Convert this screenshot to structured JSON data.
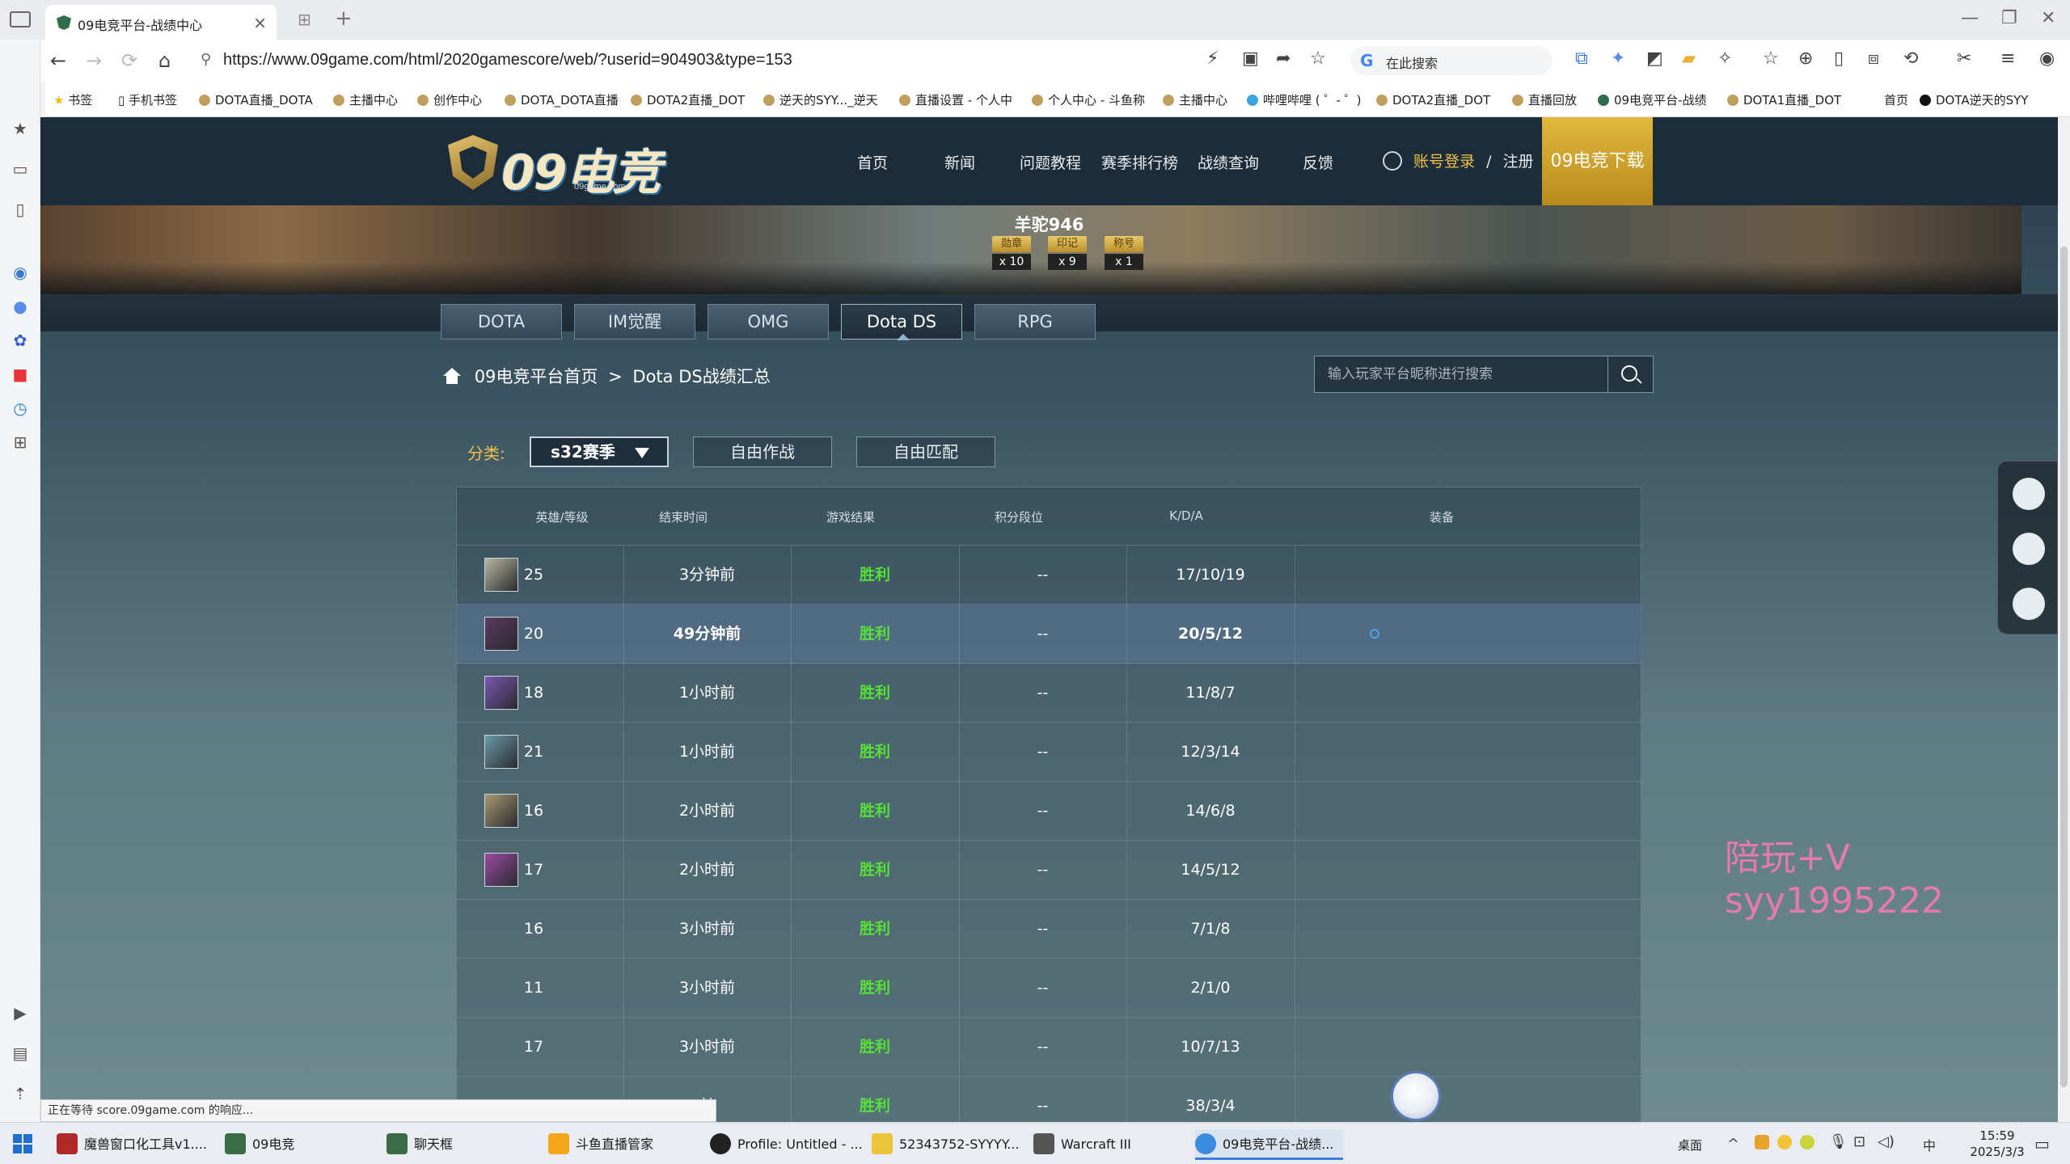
{
  "browser": {
    "tab_title": "09电竞平台-战绩中心",
    "url": "https://www.09game.com/html/2020gamescore/web/?userid=904903&type=153",
    "search_placeholder": "在此搜索",
    "bookmarks": [
      "书签",
      "手机书签",
      "DOTA直播_DOTA",
      "主播中心",
      "创作中心",
      "DOTA_DOTA直播",
      "DOTA2直播_DOT",
      "逆天的SYY..._逆天",
      "直播设置 - 个人中",
      "个人中心 - 斗鱼称",
      "主播中心",
      "哔哩哔哩 ( ゜- ゜)",
      "DOTA2直播_DOT",
      "直播回放",
      "09电竞平台-战绩",
      "DOTA1直播_DOT",
      "首页",
      "DOTA逆天的SYY"
    ],
    "status": "正在等待 score.09game.com 的响应..."
  },
  "site": {
    "logo_text": "09电竞",
    "logo_sub": "09game.com",
    "nav": [
      "首页",
      "新闻",
      "问题教程",
      "赛季排行榜",
      "战绩查询",
      "反馈"
    ],
    "login": "账号登录",
    "login_sep": "/",
    "register": "注册",
    "download": "09电竞下载"
  },
  "profile": {
    "username": "羊驼946",
    "badges": [
      {
        "label": "勋章",
        "count": "x 10"
      },
      {
        "label": "印记",
        "count": "x 9"
      },
      {
        "label": "称号",
        "count": "x 1"
      }
    ]
  },
  "game_tabs": [
    "DOTA",
    "IM觉醒",
    "OMG",
    "Dota DS",
    "RPG"
  ],
  "active_tab": "Dota DS",
  "breadcrumb": {
    "home": "09电竞平台首页",
    "sep": ">",
    "current": "Dota DS战绩汇总"
  },
  "search": {
    "placeholder": "输入玩家平台昵称进行搜索"
  },
  "filter": {
    "label": "分类:",
    "season": "s32赛季",
    "modes": [
      "自由作战",
      "自由匹配"
    ]
  },
  "table": {
    "headers": [
      "英雄/等级",
      "结束时间",
      "游戏结果",
      "积分段位",
      "K/D/A",
      "装备"
    ],
    "rows": [
      {
        "level": "25",
        "time": "3分钟前",
        "result": "胜利",
        "rank": "--",
        "kda": "17/10/19",
        "hero_color": "#b8b8a0"
      },
      {
        "level": "20",
        "time": "49分钟前",
        "result": "胜利",
        "rank": "--",
        "kda": "20/5/12",
        "hero_color": "#5a3a5e"
      },
      {
        "level": "18",
        "time": "1小时前",
        "result": "胜利",
        "rank": "--",
        "kda": "11/8/7",
        "hero_color": "#7a58b0"
      },
      {
        "level": "21",
        "time": "1小时前",
        "result": "胜利",
        "rank": "--",
        "kda": "12/3/14",
        "hero_color": "#6a9aa8"
      },
      {
        "level": "16",
        "time": "2小时前",
        "result": "胜利",
        "rank": "--",
        "kda": "14/6/8",
        "hero_color": "#a89870"
      },
      {
        "level": "17",
        "time": "2小时前",
        "result": "胜利",
        "rank": "--",
        "kda": "14/5/12",
        "hero_color": "#9a4aa0"
      },
      {
        "level": "16",
        "time": "3小时前",
        "result": "胜利",
        "rank": "--",
        "kda": "7/1/8",
        "hero_color": ""
      },
      {
        "level": "11",
        "time": "3小时前",
        "result": "胜利",
        "rank": "--",
        "kda": "2/1/0",
        "hero_color": ""
      },
      {
        "level": "17",
        "time": "3小时前",
        "result": "胜利",
        "rank": "--",
        "kda": "10/7/13",
        "hero_color": ""
      },
      {
        "level": "",
        "time": "前",
        "result": "胜利",
        "rank": "--",
        "kda": "38/3/4",
        "hero_color": ""
      }
    ]
  },
  "watermark": "陪玩+V syy1995222",
  "taskbar": {
    "items": [
      "魔兽窗口化工具v1....",
      "09电竞",
      "聊天框",
      "斗鱼直播管家",
      "Profile: Untitled - ...",
      "52343752-SYYYY...",
      "Warcraft III",
      "09电竞平台-战绩..."
    ],
    "desktop": "桌面",
    "ime": "中",
    "time": "15:59",
    "date": "2025/3/3"
  }
}
